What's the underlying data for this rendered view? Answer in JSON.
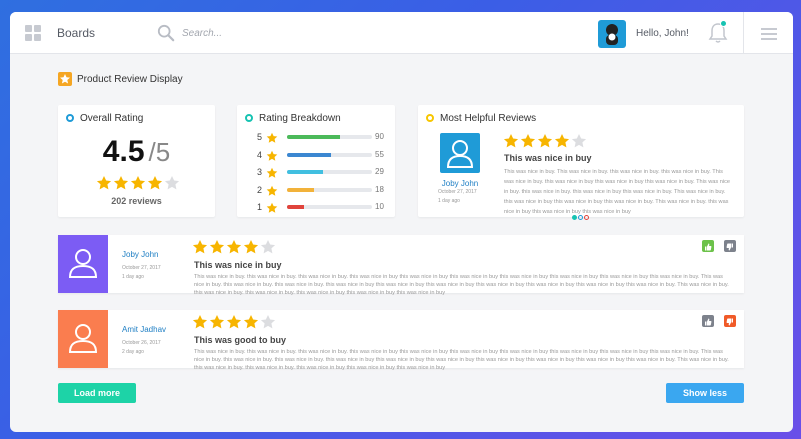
{
  "header": {
    "brand": "Boards",
    "search_placeholder": "Search...",
    "greeting": "Hello, John!"
  },
  "page": {
    "title": "Product Review Display"
  },
  "overall": {
    "title": "Overall Rating",
    "score": "4.5",
    "out_of": "/5",
    "stars": 4,
    "reviews": "202 reviews"
  },
  "breakdown": {
    "title": "Rating Breakdown",
    "rows": [
      {
        "label": "5",
        "count": "90",
        "fraction": 0.62,
        "color": "#4cba5a"
      },
      {
        "label": "4",
        "count": "55",
        "fraction": 0.52,
        "color": "#3b87d1"
      },
      {
        "label": "3",
        "count": "29",
        "fraction": 0.42,
        "color": "#41bfe0"
      },
      {
        "label": "2",
        "count": "18",
        "fraction": 0.32,
        "color": "#f2b23a"
      },
      {
        "label": "1",
        "count": "10",
        "fraction": 0.2,
        "color": "#e0443c"
      }
    ]
  },
  "helpful": {
    "title": "Most Helpful Reviews",
    "name": "Joby John",
    "date": "October 27, 2017",
    "ago": "1 day ago",
    "stars": 4,
    "review_title": "This was nice in buy",
    "body": "This was nice in buy. This was nice in buy. this was nice in buy. this was nice in buy. This was nice in buy. this was nice in buy this was nice in buy this was nice in buy. This was nice in buy. this was nice in buy. this was nice in buy this was nice in buy. This was nice in buy. this was nice in buy this was nice in buy this was nice in buy. This was nice in buy. this was nice in buy this was nice in buy this was nice in buy"
  },
  "reviews": [
    {
      "name": "Joby John",
      "date": "October 27, 2017",
      "ago": "1 day ago",
      "stars": 4,
      "title": "This was nice in buy",
      "body": "This was nice in buy. this was nice in buy. this was nice in buy. this was nice in buy this was nice in buy this was nice in buy this was nice in buy this was nice in buy this was nice in buy this was nice in buy. This was nice in buy. this was nice in buy. this was nice in buy. this was nice in buy this was nice in buy this was nice in buy this was nice in buy this was nice in buy this was nice in buy this was nice in buy. This was nice in buy. this was nice in buy. this was nice in buy. this was nice in buy this was nice in buy this was nice in buy",
      "side_color": "#7c5cf4",
      "thumb_up_color": "#6cc24a",
      "thumb_down_color": "#7d828c"
    },
    {
      "name": "Amit Jadhav",
      "date": "October 26, 2017",
      "ago": "2 day ago",
      "stars": 4,
      "title": "This was good to buy",
      "body": "This was nice in buy. this was nice in buy. this was nice in buy. this was nice in buy this was nice in buy this was nice in buy this was nice in buy this was nice in buy this was nice in buy this was nice in buy. This was nice in buy. this was nice in buy. this was nice in buy. this was nice in buy this was nice in buy this was nice in buy this was nice in buy this was nice in buy this was nice in buy this was nice in buy. This was nice in buy. this was nice in buy. this was nice in buy. this was nice in buy this was nice in buy this was nice in buy",
      "side_color": "#fa7d4f",
      "thumb_up_color": "#7d828c",
      "thumb_down_color": "#f05a28"
    }
  ],
  "buttons": {
    "load_more": "Load more",
    "show_less": "Show less"
  },
  "colors": {
    "star_on": "#f7b500",
    "star_off": "#dcdde0",
    "ring_overall": "#1f9bd7",
    "ring_breakdown": "#17c3b2",
    "ring_helpful": "#f7c600"
  },
  "icons": [
    "grid-icon",
    "search-icon",
    "bell-icon",
    "menu-icon",
    "star-icon",
    "user-icon",
    "thumbs-up-icon",
    "thumbs-down-icon"
  ]
}
